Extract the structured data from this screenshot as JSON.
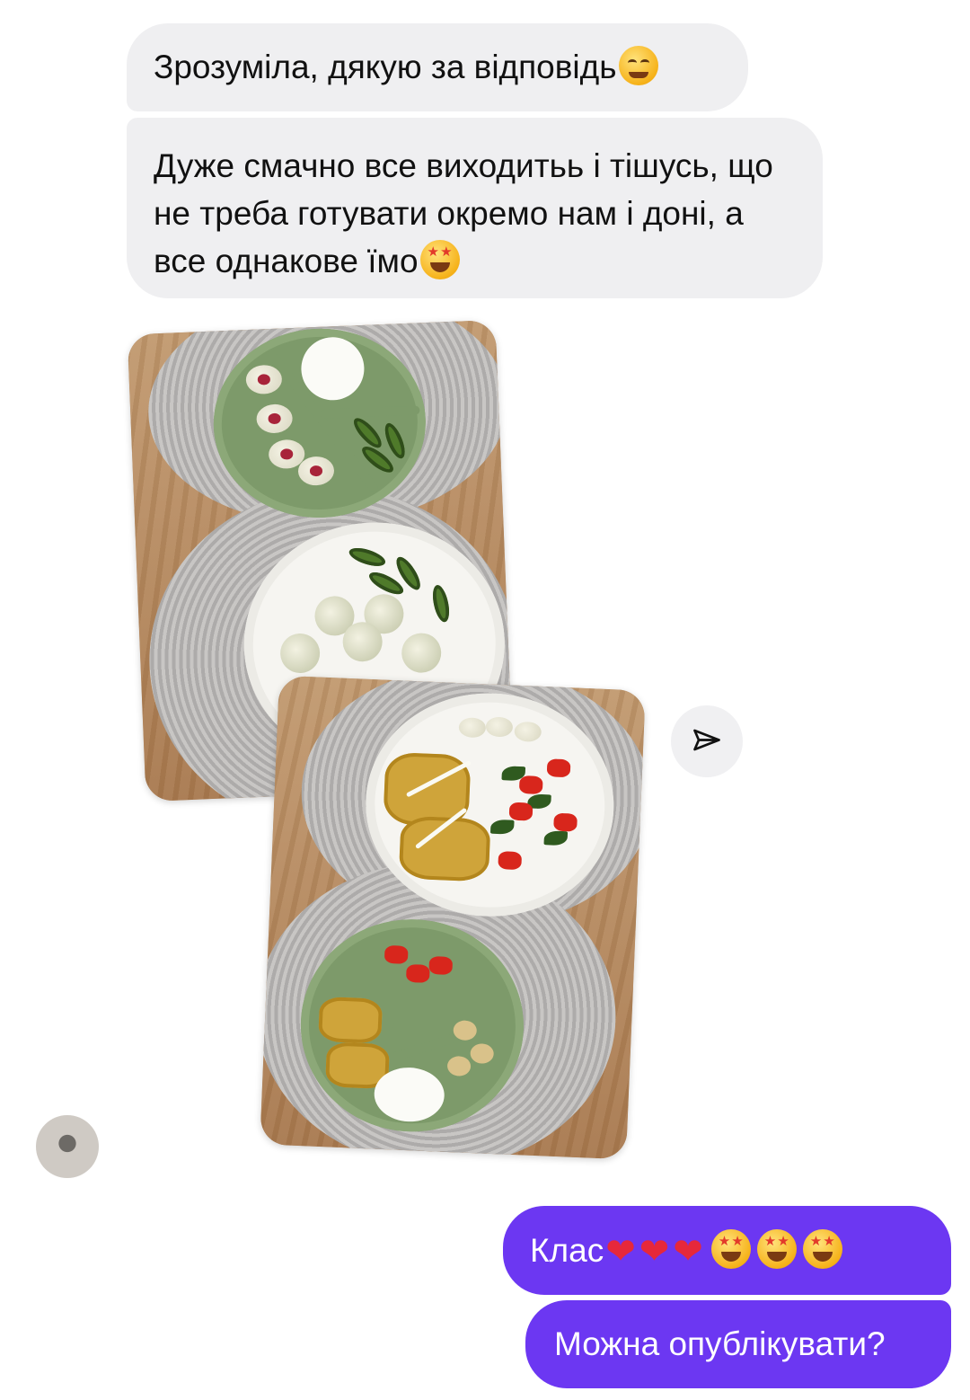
{
  "thread": {
    "incoming": [
      {
        "text": "Зрозуміла, дякую за відповідь",
        "emoji": [
          "smiling-face-with-open-hands"
        ]
      },
      {
        "text": "Дуже смачно все виходитьь і тішусь, що не треба готувати окремо нам і доні, а все однакове їмо",
        "emoji": [
          "star-struck"
        ]
      }
    ],
    "photos": [
      {
        "description_icon": "meal-photo-icon"
      },
      {
        "description_icon": "meal-photo-icon"
      }
    ],
    "outgoing": [
      {
        "text": "Клас",
        "emoji": [
          "heart-on-fire",
          "heart-on-fire",
          "heart-on-fire",
          "star-struck",
          "star-struck",
          "star-struck"
        ]
      },
      {
        "text": "Можна опублікувати?"
      }
    ]
  },
  "colors": {
    "incoming_bubble": "#efeff1",
    "outgoing_bubble": "#6c37f2",
    "outgoing_text": "#ffffff"
  },
  "icons": {
    "share": "paper-plane-icon",
    "avatar": "user-avatar"
  }
}
